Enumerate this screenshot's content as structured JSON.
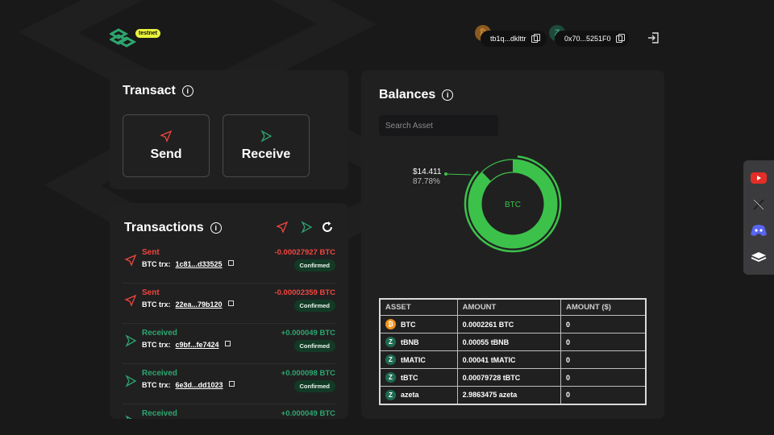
{
  "header": {
    "network_badge": "testnet",
    "btc_address": "tb1q...dklttr",
    "zeta_address": "0x70...5251F0",
    "btc_chain_icon": "bitcoin-icon",
    "zeta_chain_icon": "zetachain-icon"
  },
  "transact": {
    "title": "Transact",
    "send_label": "Send",
    "receive_label": "Receive"
  },
  "transactions": {
    "title": "Transactions",
    "items": [
      {
        "direction": "Sent",
        "trx_label": "BTC trx:",
        "hash": "1c81...d33525",
        "amount": "-0.00027927 BTC",
        "status": "Confirmed"
      },
      {
        "direction": "Sent",
        "trx_label": "BTC trx:",
        "hash": "22ea...79b120",
        "amount": "-0.00002359 BTC",
        "status": "Confirmed"
      },
      {
        "direction": "Received",
        "trx_label": "BTC trx:",
        "hash": "c9bf...fe7424",
        "amount": "+0.000049 BTC",
        "status": "Confirmed"
      },
      {
        "direction": "Received",
        "trx_label": "BTC trx:",
        "hash": "6e3d...dd1023",
        "amount": "+0.000098 BTC",
        "status": "Confirmed"
      },
      {
        "direction": "Received",
        "trx_label": "",
        "hash": "",
        "amount": "+0.000049 BTC",
        "status": ""
      }
    ]
  },
  "balances": {
    "title": "Balances",
    "search_placeholder": "Search Asset",
    "donut_center": "BTC",
    "donut_value": "$14.411",
    "donut_pct": "87.78%",
    "donut_fraction": 0.8778,
    "columns": [
      "ASSET",
      "AMOUNT",
      "AMOUNT ($)"
    ],
    "rows": [
      {
        "asset": "BTC",
        "icon": "btc",
        "amount": "0.0002261 BTC",
        "usd": "0"
      },
      {
        "asset": "tBNB",
        "icon": "zeta",
        "amount": "0.00055 tBNB",
        "usd": "0"
      },
      {
        "asset": "tMATIC",
        "icon": "zeta",
        "amount": "0.00041 tMATIC",
        "usd": "0"
      },
      {
        "asset": "tBTC",
        "icon": "zeta",
        "amount": "0.00079728 tBTC",
        "usd": "0"
      },
      {
        "asset": "azeta",
        "icon": "zeta",
        "amount": "2.9863475 azeta",
        "usd": "0"
      }
    ]
  },
  "colors": {
    "accent_green": "#3cc24a",
    "sent_red": "#f0463f",
    "received_green": "#2ea66f"
  },
  "social": [
    "youtube-icon",
    "x-icon",
    "discord-icon",
    "docs-icon"
  ]
}
